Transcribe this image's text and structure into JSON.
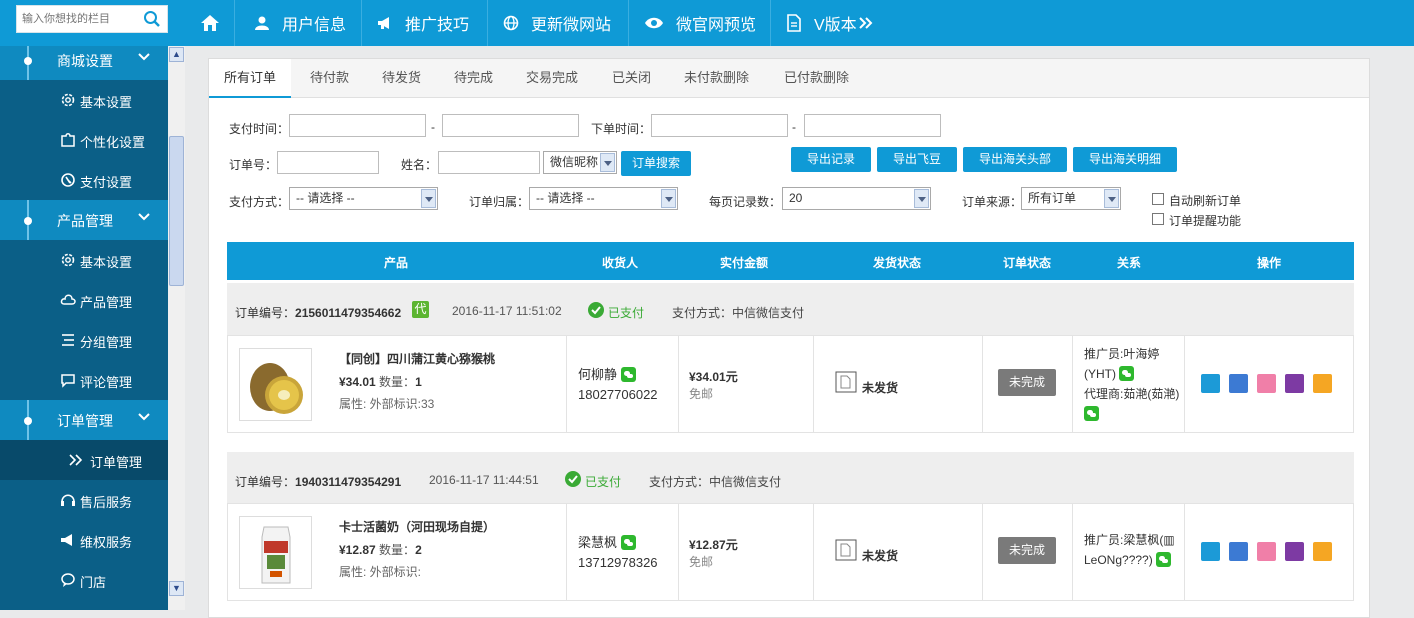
{
  "topbar": {
    "search_placeholder": "输入你想找的栏目",
    "nav": [
      {
        "label": "用户信息",
        "icon": "user-icon"
      },
      {
        "label": "推广技巧",
        "icon": "megaphone-icon"
      },
      {
        "label": "更新微网站",
        "icon": "globe-icon"
      },
      {
        "label": "微官网预览",
        "icon": "eye-icon"
      },
      {
        "label": "V版本",
        "icon": "document-icon"
      }
    ]
  },
  "sidebar": {
    "groups": [
      {
        "label": "商城设置",
        "items": [
          {
            "label": "基本设置",
            "icon": "gear-icon"
          },
          {
            "label": "个性化设置",
            "icon": "puzzle-icon"
          },
          {
            "label": "支付设置",
            "icon": "payment-icon"
          }
        ]
      },
      {
        "label": "产品管理",
        "items": [
          {
            "label": "基本设置",
            "icon": "gear-icon"
          },
          {
            "label": "产品管理",
            "icon": "cloud-icon"
          },
          {
            "label": "分组管理",
            "icon": "list-icon"
          },
          {
            "label": "评论管理",
            "icon": "comment-icon"
          }
        ]
      },
      {
        "label": "订单管理",
        "items": [
          {
            "label": "订单管理",
            "icon": "double-chevron-icon"
          },
          {
            "label": "售后服务",
            "icon": "headset-icon"
          },
          {
            "label": "维权服务",
            "icon": "megaphone-icon"
          },
          {
            "label": "门店",
            "icon": "chat-icon"
          }
        ]
      }
    ]
  },
  "tabs": [
    "所有订单",
    "待付款",
    "待发货",
    "待完成",
    "交易完成",
    "已关闭",
    "未付款删除",
    "已付款删除"
  ],
  "filters": {
    "pay_time_label": "支付时间：",
    "order_time_label": "下单时间：",
    "dash": "-",
    "order_no_label": "订单号：",
    "name_label": "姓名：",
    "name_type": "微信昵称",
    "search_btn": "订单搜索",
    "export_buttons": [
      "导出记录",
      "导出飞豆",
      "导出海关头部",
      "导出海关明细"
    ],
    "pay_method_label": "支付方式：",
    "pay_method_value": "-- 请选择 --",
    "order_owner_label": "订单归属：",
    "order_owner_value": "-- 请选择 --",
    "page_size_label": "每页记录数：",
    "page_size_value": "20",
    "source_label": "订单来源：",
    "source_value": "所有订单",
    "auto_refresh": "自动刷新订单",
    "reminder": "订单提醒功能"
  },
  "table_headers": [
    "产品",
    "收货人",
    "实付金额",
    "发货状态",
    "订单状态",
    "关系",
    "操作"
  ],
  "orders": [
    {
      "order_no_label": "订单编号：",
      "order_no": "2156011479354662",
      "dai_badge": "代",
      "time": "2016-11-17 11:51:02",
      "paid": "已支付",
      "pay_method": "支付方式：中信微信支付",
      "product_name": "【同创】四川蒲江黄心猕猴桃",
      "price": "¥34.01",
      "qty_label": "数量：",
      "qty": "1",
      "attr": "属性: 外部标识:33",
      "receiver": "何柳静",
      "phone": "18027706022",
      "amount": "¥34.01元",
      "shipping_fee": "免邮",
      "ship_status": "未发货",
      "order_status": "未完成",
      "relation_line1": "推广员:叶海婷",
      "relation_line2": "(YHT)",
      "relation_line3": "代理商:茹滟(茹滟)"
    },
    {
      "order_no_label": "订单编号：",
      "order_no": "1940311479354291",
      "time": "2016-11-17 11:44:51",
      "paid": "已支付",
      "pay_method": "支付方式：中信微信支付",
      "product_name": "卡士活菌奶（河田现场自提）",
      "price": "¥12.87",
      "qty_label": "数量：",
      "qty": "2",
      "attr": "属性: 外部标识:",
      "receiver": "梁慧枫",
      "phone": "13712978326",
      "amount": "¥12.87元",
      "shipping_fee": "免邮",
      "ship_status": "未发货",
      "order_status": "未完成",
      "relation_line1": "推广员:梁慧枫(▥",
      "relation_line2": "LeONg????)"
    }
  ],
  "colors": {
    "primary": "#0f9ad6",
    "sidebar": "#0b5f87",
    "paid_green": "#3aaa35"
  }
}
